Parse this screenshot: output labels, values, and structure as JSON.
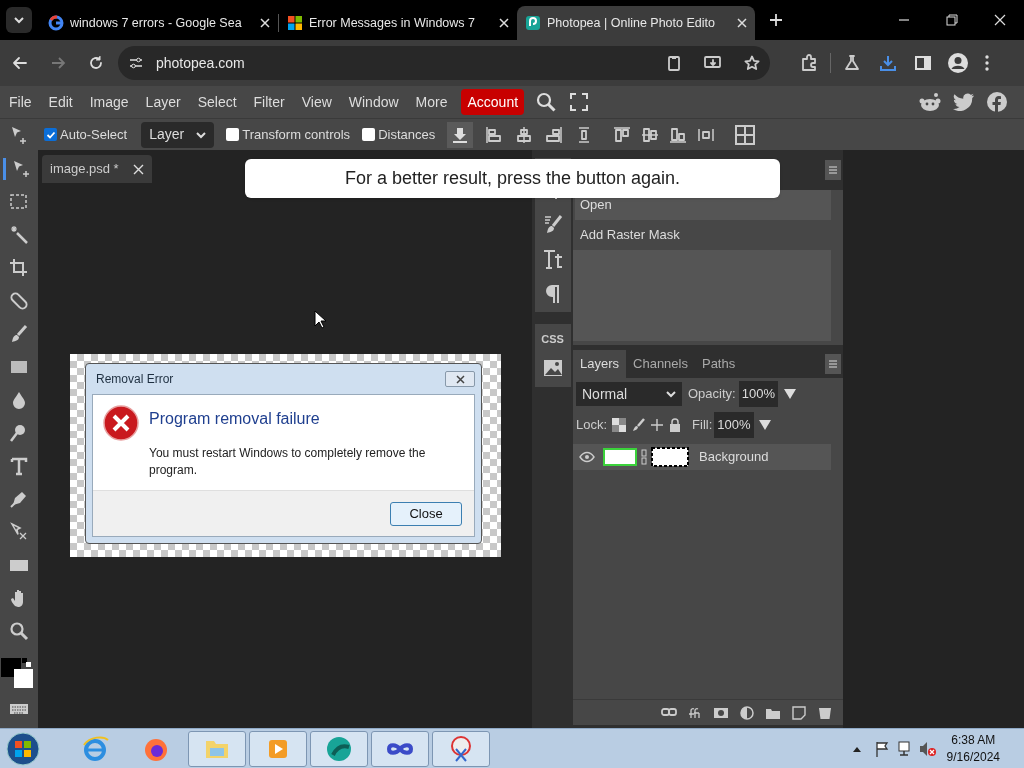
{
  "browser": {
    "tabs": [
      {
        "title": "windows 7 errors - Google Sea",
        "selected": false,
        "kind": "google"
      },
      {
        "title": "Error Messages in Windows 7",
        "selected": false,
        "kind": "windows"
      },
      {
        "title": "Photopea | Online Photo Edito",
        "selected": true,
        "kind": "photopea"
      }
    ],
    "address": "photopea.com"
  },
  "menu": [
    {
      "label": "File",
      "highlighted": false
    },
    {
      "label": "Edit",
      "highlighted": false
    },
    {
      "label": "Image",
      "highlighted": false
    },
    {
      "label": "Layer",
      "highlighted": false
    },
    {
      "label": "Select",
      "highlighted": false
    },
    {
      "label": "Filter",
      "highlighted": false
    },
    {
      "label": "View",
      "highlighted": false
    },
    {
      "label": "Window",
      "highlighted": false
    },
    {
      "label": "More",
      "highlighted": false
    },
    {
      "label": "Account",
      "highlighted": true
    }
  ],
  "options": {
    "auto_select": {
      "label": "Auto-Select",
      "checked": true
    },
    "target": "Layer",
    "transform_controls": {
      "label": "Transform controls",
      "checked": false
    },
    "distances": {
      "label": "Distances",
      "checked": false
    }
  },
  "document_tab": "image.psd *",
  "toast": "For a better result, press the button again.",
  "dialog": {
    "title": "Removal Error",
    "heading": "Program removal failure",
    "message": "You must restart Windows to completely remove the program.",
    "button": "Close"
  },
  "side_column": {
    "css_label": "CSS"
  },
  "history": [
    "Open",
    "Add Raster Mask"
  ],
  "layers_panel": {
    "tabs": [
      {
        "label": "Layers",
        "selected": true
      },
      {
        "label": "Channels",
        "selected": false
      },
      {
        "label": "Paths",
        "selected": false
      }
    ],
    "blend_mode": "Normal",
    "opacity_label": "Opacity:",
    "opacity": "100%",
    "lock_label": "Lock:",
    "fill_label": "Fill:",
    "fill": "100%",
    "layers": [
      {
        "name": "Background",
        "visible": true
      }
    ]
  },
  "taskbar": {
    "time": "6:38 AM",
    "date": "9/16/2024"
  }
}
